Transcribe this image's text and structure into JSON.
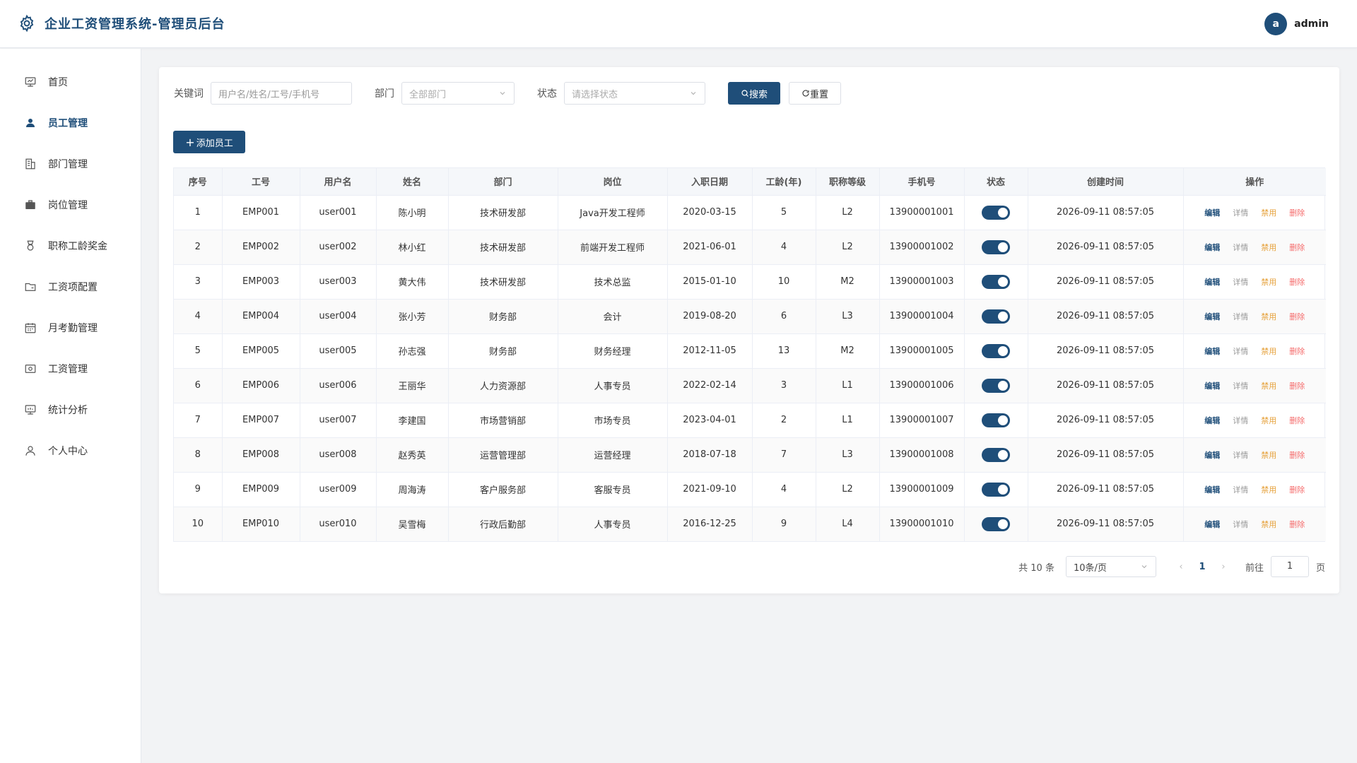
{
  "app": {
    "title": "企业工资管理系统-管理员后台"
  },
  "user": {
    "avatar_letter": "a",
    "name": "admin"
  },
  "sidebar": {
    "items": [
      {
        "label": "首页",
        "icon": "dashboard-icon"
      },
      {
        "label": "员工管理",
        "icon": "user-icon",
        "active": true
      },
      {
        "label": "部门管理",
        "icon": "building-icon"
      },
      {
        "label": "岗位管理",
        "icon": "briefcase-icon"
      },
      {
        "label": "职称工龄奖金",
        "icon": "medal-icon"
      },
      {
        "label": "工资项配置",
        "icon": "folder-icon"
      },
      {
        "label": "月考勤管理",
        "icon": "calendar-icon"
      },
      {
        "label": "工资管理",
        "icon": "money-icon"
      },
      {
        "label": "统计分析",
        "icon": "chart-icon"
      },
      {
        "label": "个人中心",
        "icon": "person-icon"
      }
    ]
  },
  "filter": {
    "keyword_label": "关键词",
    "keyword_placeholder": "用户名/姓名/工号/手机号",
    "dept_label": "部门",
    "dept_placeholder": "全部部门",
    "status_label": "状态",
    "status_placeholder": "请选择状态",
    "search_label": "搜索",
    "reset_label": "重置"
  },
  "toolbar": {
    "add_label": "添加员工"
  },
  "table": {
    "columns": [
      "序号",
      "工号",
      "用户名",
      "姓名",
      "部门",
      "岗位",
      "入职日期",
      "工龄(年)",
      "职称等级",
      "手机号",
      "状态",
      "创建时间",
      "操作"
    ],
    "actions": {
      "edit": "编辑",
      "detail": "详情",
      "disable": "禁用",
      "delete": "删除"
    },
    "rows": [
      {
        "no": "1",
        "emp_id": "EMP001",
        "username": "user001",
        "name": "陈小明",
        "dept": "技术研发部",
        "post": "Java开发工程师",
        "hire_date": "2020-03-15",
        "years": "5",
        "level": "L2",
        "phone": "13900001001",
        "enabled": true,
        "created": "2026-09-11 08:57:05"
      },
      {
        "no": "2",
        "emp_id": "EMP002",
        "username": "user002",
        "name": "林小红",
        "dept": "技术研发部",
        "post": "前端开发工程师",
        "hire_date": "2021-06-01",
        "years": "4",
        "level": "L2",
        "phone": "13900001002",
        "enabled": true,
        "created": "2026-09-11 08:57:05"
      },
      {
        "no": "3",
        "emp_id": "EMP003",
        "username": "user003",
        "name": "黄大伟",
        "dept": "技术研发部",
        "post": "技术总监",
        "hire_date": "2015-01-10",
        "years": "10",
        "level": "M2",
        "phone": "13900001003",
        "enabled": true,
        "created": "2026-09-11 08:57:05"
      },
      {
        "no": "4",
        "emp_id": "EMP004",
        "username": "user004",
        "name": "张小芳",
        "dept": "财务部",
        "post": "会计",
        "hire_date": "2019-08-20",
        "years": "6",
        "level": "L3",
        "phone": "13900001004",
        "enabled": true,
        "created": "2026-09-11 08:57:05"
      },
      {
        "no": "5",
        "emp_id": "EMP005",
        "username": "user005",
        "name": "孙志强",
        "dept": "财务部",
        "post": "财务经理",
        "hire_date": "2012-11-05",
        "years": "13",
        "level": "M2",
        "phone": "13900001005",
        "enabled": true,
        "created": "2026-09-11 08:57:05"
      },
      {
        "no": "6",
        "emp_id": "EMP006",
        "username": "user006",
        "name": "王丽华",
        "dept": "人力资源部",
        "post": "人事专员",
        "hire_date": "2022-02-14",
        "years": "3",
        "level": "L1",
        "phone": "13900001006",
        "enabled": true,
        "created": "2026-09-11 08:57:05"
      },
      {
        "no": "7",
        "emp_id": "EMP007",
        "username": "user007",
        "name": "李建国",
        "dept": "市场营销部",
        "post": "市场专员",
        "hire_date": "2023-04-01",
        "years": "2",
        "level": "L1",
        "phone": "13900001007",
        "enabled": true,
        "created": "2026-09-11 08:57:05"
      },
      {
        "no": "8",
        "emp_id": "EMP008",
        "username": "user008",
        "name": "赵秀英",
        "dept": "运营管理部",
        "post": "运营经理",
        "hire_date": "2018-07-18",
        "years": "7",
        "level": "L3",
        "phone": "13900001008",
        "enabled": true,
        "created": "2026-09-11 08:57:05"
      },
      {
        "no": "9",
        "emp_id": "EMP009",
        "username": "user009",
        "name": "周海涛",
        "dept": "客户服务部",
        "post": "客服专员",
        "hire_date": "2021-09-10",
        "years": "4",
        "level": "L2",
        "phone": "13900001009",
        "enabled": true,
        "created": "2026-09-11 08:57:05"
      },
      {
        "no": "10",
        "emp_id": "EMP010",
        "username": "user010",
        "name": "吴雪梅",
        "dept": "行政后勤部",
        "post": "人事专员",
        "hire_date": "2016-12-25",
        "years": "9",
        "level": "L4",
        "phone": "13900001010",
        "enabled": true,
        "created": "2026-09-11 08:57:05"
      }
    ]
  },
  "pagination": {
    "total_text": "共 10 条",
    "page_size": "10条/页",
    "current_page": "1",
    "goto_label": "前往",
    "goto_value": "1",
    "page_suffix": "页"
  },
  "colors": {
    "primary": "#1f4e79",
    "warning": "#e6a23c",
    "danger": "#f56c6c"
  }
}
